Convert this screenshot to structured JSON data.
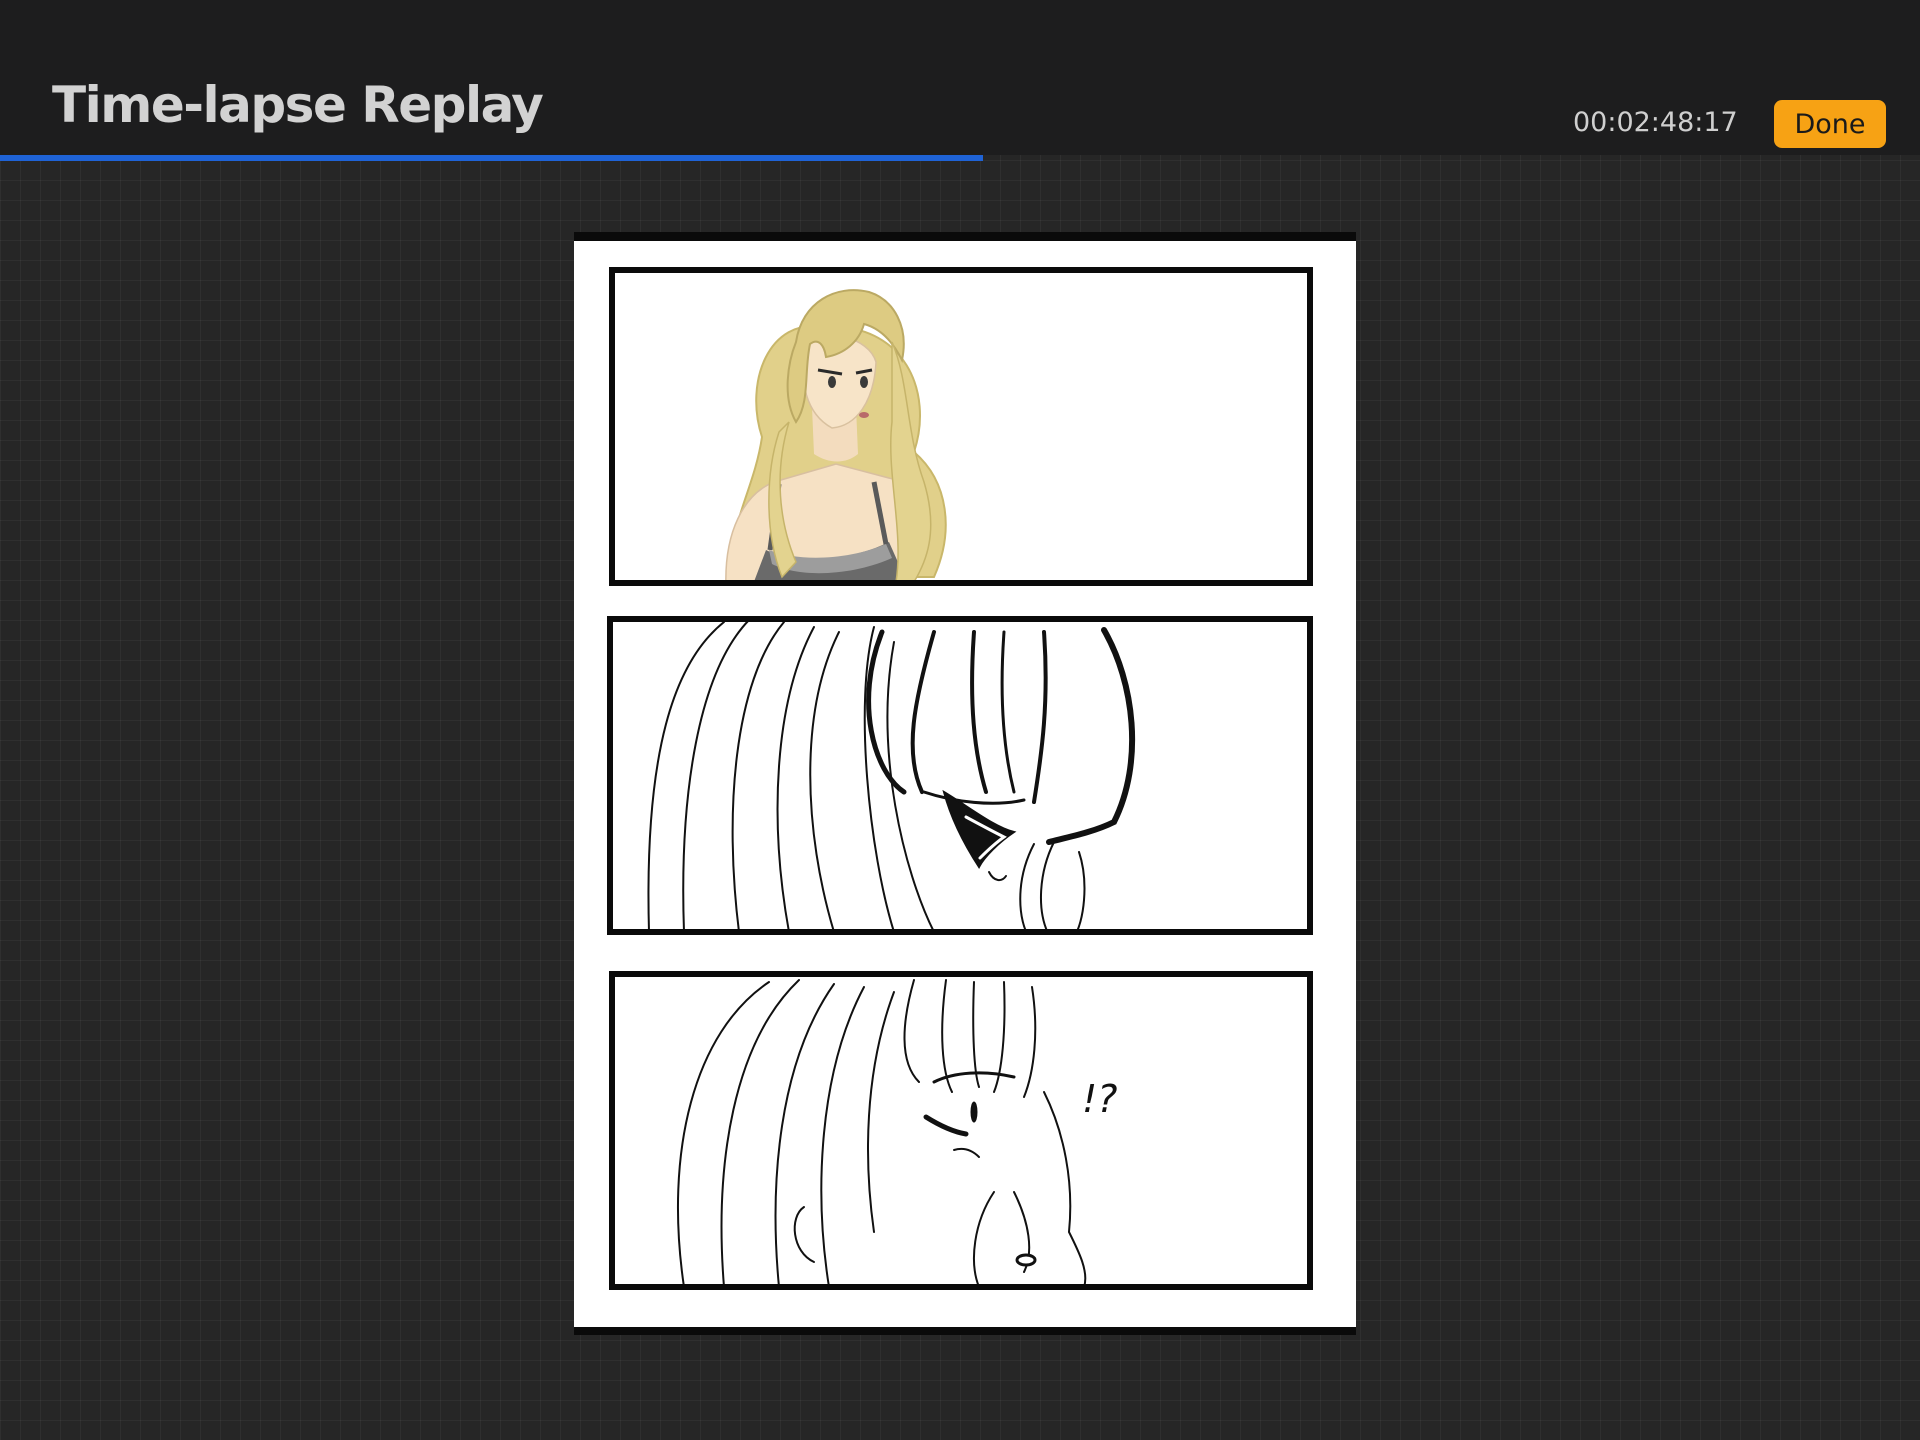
{
  "header": {
    "title": "Time-lapse Replay",
    "timecode": "00:02:48:17",
    "done_label": "Done"
  },
  "playback": {
    "progress": 0.512
  },
  "artwork": {
    "sfx_text": "!?"
  },
  "colors": {
    "accent": "#f7a214",
    "progress": "#1f63d6",
    "toolbar_bg": "#1d1d1e",
    "workspace_bg": "#262626"
  },
  "icons": {
    "done": "text-button"
  }
}
